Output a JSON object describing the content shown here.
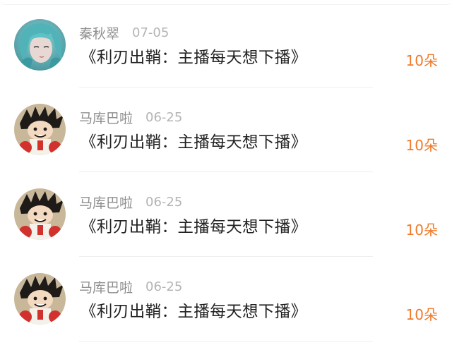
{
  "comments": [
    {
      "username": "秦秋翠",
      "date": "07-05",
      "content": "《利刃出鞘：主播每天想下播》",
      "gift": "10朵",
      "avatar_icon": "anime-girl-avatar-icon"
    },
    {
      "username": "马库巴啦",
      "date": "06-25",
      "content": "《利刃出鞘：主播每天想下播》",
      "gift": "10朵",
      "avatar_icon": "anime-boy-boxer-avatar-icon"
    },
    {
      "username": "马库巴啦",
      "date": "06-25",
      "content": "《利刃出鞘：主播每天想下播》",
      "gift": "10朵",
      "avatar_icon": "anime-boy-boxer-avatar-icon"
    },
    {
      "username": "马库巴啦",
      "date": "06-25",
      "content": "《利刃出鞘：主播每天想下播》",
      "gift": "10朵",
      "avatar_icon": "anime-boy-boxer-avatar-icon"
    }
  ],
  "colors": {
    "gift_accent": "#f07a2a",
    "username": "#8f8f8f",
    "date": "#b4b4b4",
    "content": "#222222"
  }
}
